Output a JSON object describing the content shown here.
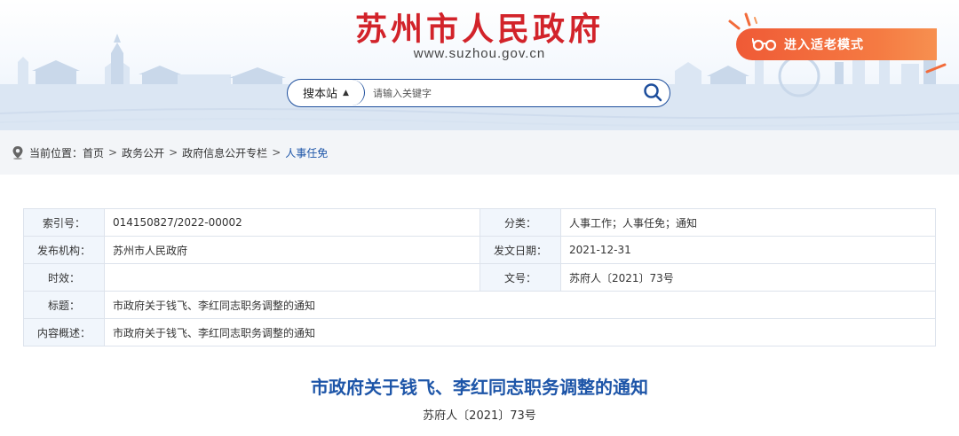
{
  "header": {
    "site_title": "苏州市人民政府",
    "site_url": "www.suzhou.gov.cn",
    "search": {
      "scope_label": "搜本站",
      "placeholder": "请输入关键字"
    },
    "elder_mode_label": "进入适老模式"
  },
  "breadcrumb": {
    "prefix": "当前位置：",
    "items": [
      "首页",
      "政务公开",
      "政府信息公开专栏",
      "人事任免"
    ],
    "separator": ">"
  },
  "meta": {
    "index_no_label": "索引号：",
    "index_no": "014150827/2022-00002",
    "category_label": "分类：",
    "category": "人事工作；人事任免；通知",
    "publisher_label": "发布机构：",
    "publisher": "苏州市人民政府",
    "date_label": "发文日期：",
    "date": "2021-12-31",
    "validity_label": "时效：",
    "validity": "",
    "doc_no_label": "文号：",
    "doc_no": "苏府人〔2021〕73号",
    "title_label": "标题：",
    "title": "市政府关于钱飞、李红同志职务调整的通知",
    "summary_label": "内容概述：",
    "summary": "市政府关于钱飞、李红同志职务调整的通知"
  },
  "document": {
    "title": "市政府关于钱飞、李红同志职务调整的通知",
    "number": "苏府人〔2021〕73号"
  },
  "colors": {
    "brand_red": "#d2232a",
    "brand_blue": "#1d55a8",
    "elder_orange": "#f26b3a",
    "label_bg": "#f1f6fc"
  }
}
